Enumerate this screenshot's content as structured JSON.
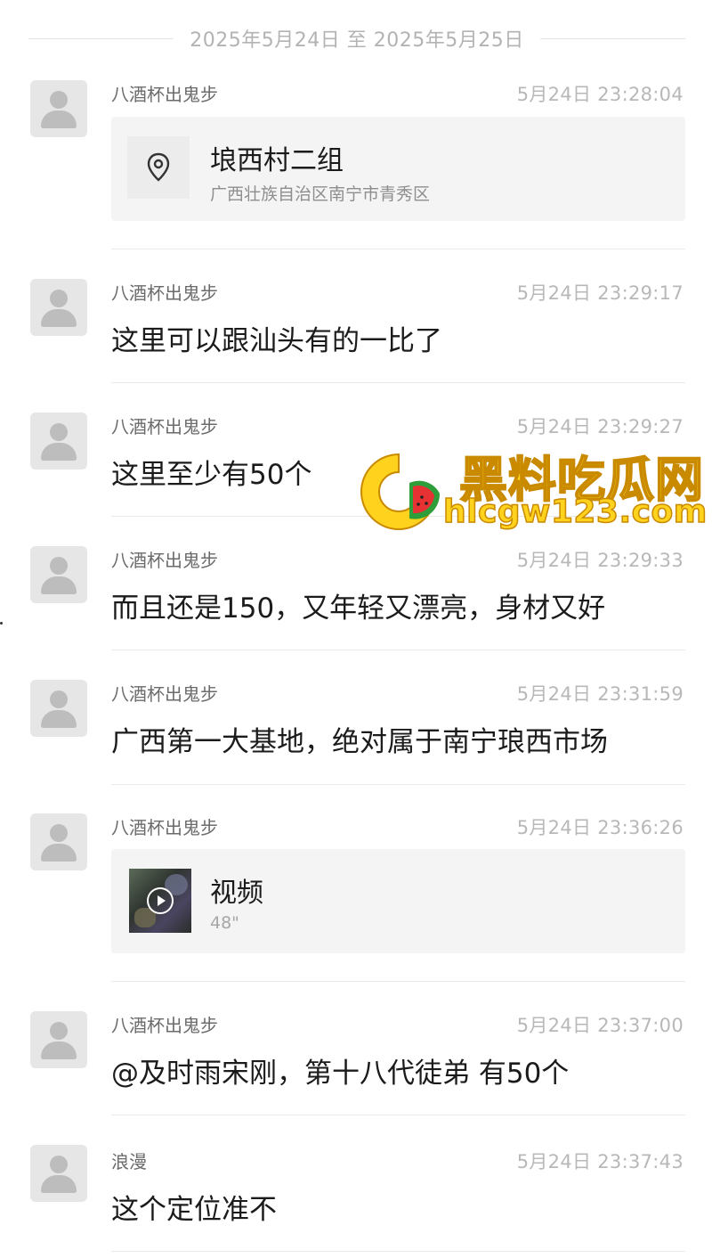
{
  "date_range": "2025年5月24日 至 2025年5月25日",
  "messages": [
    {
      "sender": "八酒杯出鬼步",
      "time": "5月24日 23:28:04",
      "type": "location",
      "location": {
        "name": "埌西村二组",
        "address": "广西壮族自治区南宁市青秀区"
      }
    },
    {
      "sender": "八酒杯出鬼步",
      "time": "5月24日 23:29:17",
      "type": "text",
      "text": "这里可以跟汕头有的一比了"
    },
    {
      "sender": "八酒杯出鬼步",
      "time": "5月24日 23:29:27",
      "type": "text",
      "text": "这里至少有50个"
    },
    {
      "sender": "八酒杯出鬼步",
      "time": "5月24日 23:29:33",
      "type": "text",
      "text": "而且还是150，又年轻又漂亮，身材又好"
    },
    {
      "sender": "八酒杯出鬼步",
      "time": "5月24日 23:31:59",
      "type": "text",
      "text": "广西第一大基地，绝对属于南宁琅西市场"
    },
    {
      "sender": "八酒杯出鬼步",
      "time": "5月24日 23:36:26",
      "type": "video",
      "video": {
        "title": "视频",
        "duration": "48\""
      }
    },
    {
      "sender": "八酒杯出鬼步",
      "time": "5月24日 23:37:00",
      "type": "text",
      "text": "@及时雨宋刚，第十八代徒弟 有50个"
    },
    {
      "sender": "浪漫",
      "time": "5月24日 23:37:43",
      "type": "text",
      "text": "这个定位准不"
    }
  ],
  "watermark": {
    "name": "黑料吃瓜网",
    "url": "hlcgw123.com"
  },
  "icons": {
    "avatar": "default-user-avatar-icon",
    "location": "location-pin-icon",
    "play": "play-icon"
  },
  "colors": {
    "background": "#ffffff",
    "card": "#f4f4f4",
    "secondary_text": "#6b6b6b",
    "timestamp": "#b8b8b8",
    "watermark": "#ffd21e"
  }
}
